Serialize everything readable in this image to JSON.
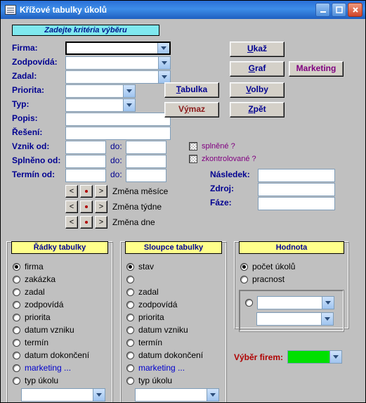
{
  "window": {
    "title": "Křížové tabulky úkolů"
  },
  "criteria_header": "Zadejte kritéria výběru",
  "labels": {
    "firma": "Firma:",
    "zodpovida": "Zodpovídá:",
    "zadal": "Zadal:",
    "priorita": "Priorita:",
    "typ": "Typ:",
    "popis": "Popis:",
    "reseni": "Řešení:",
    "vznik_od": "Vznik od:",
    "splneno_od": "Splněno od:",
    "termin_od": "Termín od:",
    "do": "do:",
    "nasledek": "Následek:",
    "zdroj": "Zdroj:",
    "faze": "Fáze:"
  },
  "buttons": {
    "ukaz": "Ukaž",
    "graf": "Graf",
    "marketing": "Marketing",
    "tabulka": "Tabulka",
    "volby": "Volby",
    "vymaz": "Výmaz",
    "zpet": "Zpět"
  },
  "checks": {
    "splnene": "splněné ?",
    "zkontrolovane": "zkontrolované ?"
  },
  "spinners": {
    "mesice": "Změna měsíce",
    "tydne": "Změna týdne",
    "dne": "Změna dne"
  },
  "groups": {
    "rows_title": "Řádky tabulky",
    "cols_title": "Sloupce tabulky",
    "val_title": "Hodnota"
  },
  "row_options": [
    {
      "label": "firma",
      "selected": true
    },
    {
      "label": "zakázka",
      "selected": false
    },
    {
      "label": "zadal",
      "selected": false
    },
    {
      "label": "zodpovídá",
      "selected": false
    },
    {
      "label": "priorita",
      "selected": false
    },
    {
      "label": "datum vzniku",
      "selected": false
    },
    {
      "label": "termín",
      "selected": false
    },
    {
      "label": "datum dokončení",
      "selected": false
    },
    {
      "label": "marketing ...",
      "selected": false,
      "link": true
    },
    {
      "label": "typ úkolu",
      "selected": false
    }
  ],
  "col_options": [
    {
      "label": "stav",
      "selected": true
    },
    {
      "label": "",
      "selected": false,
      "blank": true
    },
    {
      "label": "zadal",
      "selected": false
    },
    {
      "label": "zodpovídá",
      "selected": false
    },
    {
      "label": "priorita",
      "selected": false
    },
    {
      "label": "datum vzniku",
      "selected": false
    },
    {
      "label": "termín",
      "selected": false
    },
    {
      "label": "datum dokončení",
      "selected": false
    },
    {
      "label": "marketing ...",
      "selected": false,
      "link": true
    },
    {
      "label": "typ úkolu",
      "selected": false
    }
  ],
  "val_options": [
    {
      "label": "počet úkolů",
      "selected": true
    },
    {
      "label": "pracnost",
      "selected": false
    }
  ],
  "vyber_firem": "Výběr firem:"
}
